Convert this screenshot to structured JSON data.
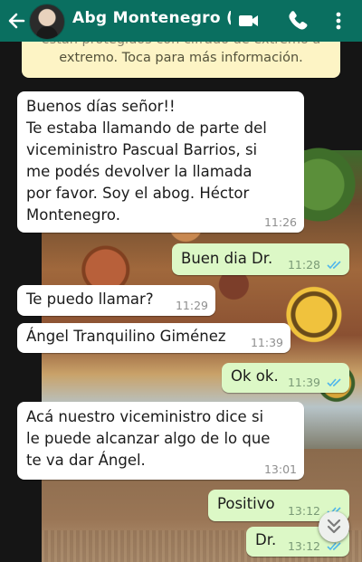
{
  "header": {
    "contact_name": "Abg Montenegro (...",
    "icons": [
      "back-arrow-icon",
      "video-call-icon",
      "phone-icon",
      "more-menu-icon"
    ]
  },
  "encryption_notice": {
    "line1": "están protegidos con cifrado de extremo a",
    "line2": "extremo. Toca para más información."
  },
  "messages": [
    {
      "dir": "in",
      "text": "Buenos días señor!!\nTe estaba llamando de parte del\nviceministro Pascual Barrios, si\nme podés devolver la llamada\npor favor. Soy el abog. Héctor\nMontenegro.",
      "time": "11:26"
    },
    {
      "dir": "out",
      "text": "Buen dia Dr.",
      "time": "11:28",
      "read": true
    },
    {
      "dir": "in",
      "text": "Te puedo llamar?",
      "time": "11:29"
    },
    {
      "dir": "in",
      "text": "Ángel Tranquilino Giménez",
      "time": "11:39"
    },
    {
      "dir": "out",
      "text": "Ok ok.",
      "time": "11:39",
      "read": true
    },
    {
      "dir": "in",
      "text": "Acá nuestro viceministro dice si\nle puede alcanzar algo de lo que\nte va dar Ángel.",
      "time": "13:01"
    },
    {
      "dir": "out",
      "text": "Positivo",
      "time": "13:12",
      "read": true
    },
    {
      "dir": "out",
      "text": "Dr.",
      "time": "13:12",
      "read": true
    }
  ],
  "colors": {
    "header": "#0a6f60",
    "incoming_bubble": "#ffffff",
    "outgoing_bubble": "#dcf8c6",
    "notice": "#fdf4c5",
    "read_tick": "#4fb6ec"
  }
}
